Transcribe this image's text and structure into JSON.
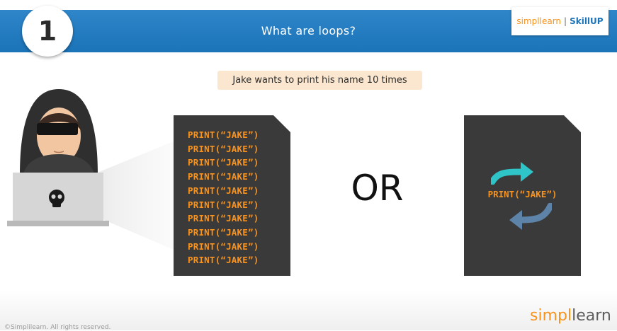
{
  "slide": {
    "number": "1",
    "title": "What are loops?",
    "caption": "Jake wants to print his name 10 times",
    "or_text": "OR"
  },
  "brand": {
    "simpl": "simpl",
    "sep": "|",
    "skillup": "SkillUP"
  },
  "code": {
    "lines": [
      "PRINT(“JAKE”)",
      "PRINT(“JAKE”)",
      "PRINT(“JAKE”)",
      "PRINT(“JAKE”)",
      "PRINT(“JAKE”)",
      "PRINT(“JAKE”)",
      "PRINT(“JAKE”)",
      "PRINT(“JAKE”)",
      "PRINT(“JAKE”)",
      "PRINT(“JAKE”)"
    ],
    "loop_line": "PRINT(“JAKE”)"
  },
  "footer": {
    "logo_left": "simpl",
    "logo_right": "learn",
    "copyright": "©Simplilearn. All rights reserved."
  },
  "colors": {
    "header_blue": "#1b73b8",
    "accent_orange": "#f7931e",
    "caption_bg": "#fbe7cf",
    "doc_bg": "#3a3a3a",
    "arrow_teal": "#2ec4c8",
    "arrow_slate": "#5e83a8"
  },
  "icons": [
    "skull-icon",
    "loop-forward-arrow-icon",
    "loop-back-arrow-icon"
  ]
}
